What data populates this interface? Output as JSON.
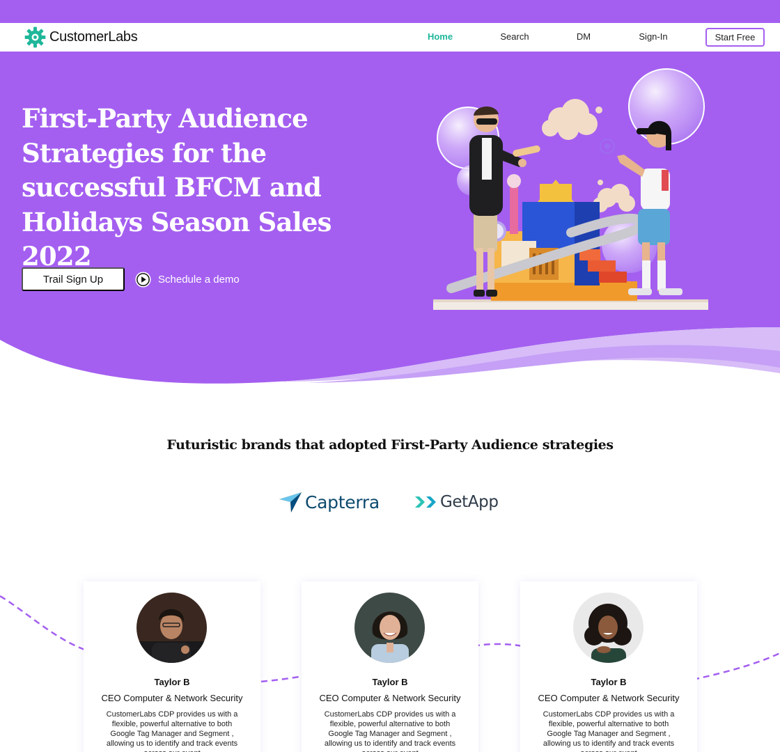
{
  "brand": {
    "name": "CustomerLabs"
  },
  "nav": {
    "links": [
      "Home",
      "Search",
      "DM",
      "Sign-In"
    ],
    "active": "Home",
    "cta": "Start Free"
  },
  "hero": {
    "title": "First-Party Audience Strategies for the successful BFCM and Holidays Season Sales 2022",
    "primary_button": "Trail Sign Up",
    "secondary_link": "Schedule a demo"
  },
  "brands": {
    "title": "Futuristic brands that adopted First-Party Audience strategies",
    "logos": [
      "Capterra",
      "GetApp"
    ]
  },
  "testimonials": [
    {
      "name": "Taylor B",
      "role": "CEO Computer & Network Security",
      "text": "CustomerLabs CDP provides us with a flexible, powerful alternative to both Google Tag Manager and Segment , allowing us to identify and track events across our event"
    },
    {
      "name": "Taylor B",
      "role": "CEO Computer & Network Security",
      "text": "CustomerLabs CDP provides us with a flexible, powerful alternative to both Google Tag Manager and Segment , allowing us to identify and track events across our event"
    },
    {
      "name": "Taylor B",
      "role": "CEO Computer & Network Security",
      "text": "CustomerLabs CDP provides us with a flexible, powerful alternative to both Google Tag Manager and Segment , allowing us to identify and track events across our event"
    }
  ],
  "colors": {
    "brand_purple": "#a45ff0",
    "nav_active": "#1fb79a",
    "logo_green": "#1fb79a"
  }
}
